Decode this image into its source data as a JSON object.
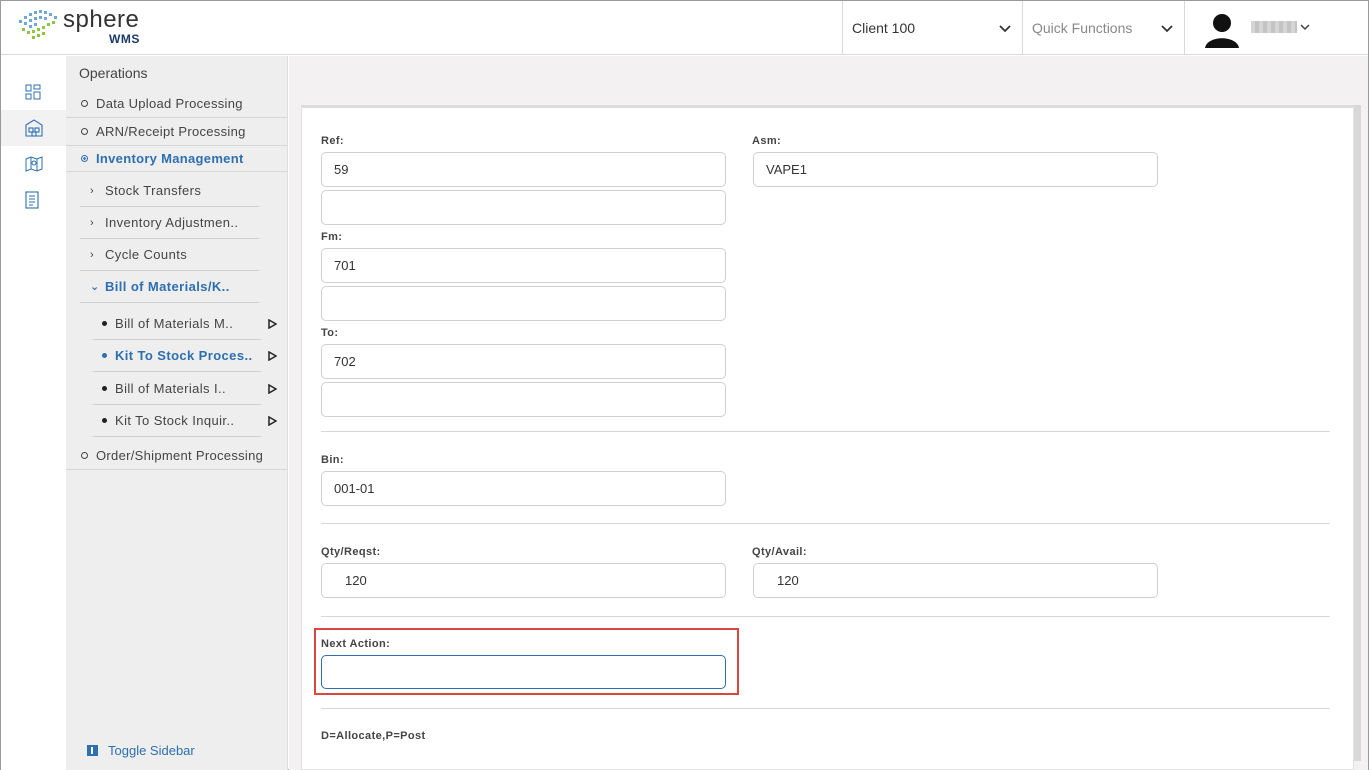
{
  "header": {
    "brand_name": "sphere",
    "brand_sub": "WMS",
    "client_select": "Client 100",
    "quick_functions": "Quick Functions"
  },
  "rail": {
    "icons": [
      "dashboard-icon",
      "warehouse-icon",
      "map-icon",
      "report-icon"
    ]
  },
  "sidebar": {
    "title": "Operations",
    "items": {
      "data_upload": "Data Upload Processing",
      "arn_receipt": "ARN/Receipt Processing",
      "inventory_mgmt": "Inventory Management",
      "stock_transfers": "Stock Transfers",
      "inventory_adjust": "Inventory Adjustmen..",
      "cycle_counts": "Cycle Counts",
      "bom_kits": "Bill of Materials/K..",
      "bom_maint": "Bill of Materials M..",
      "kit_to_stock_proc": "Kit To Stock Proces..",
      "bom_inquiry": "Bill of Materials I..",
      "kit_to_stock_inq": "Kit To Stock Inquir..",
      "order_shipment": "Order/Shipment Processing"
    },
    "toggle": "Toggle Sidebar"
  },
  "form": {
    "ref_label": "Ref:",
    "ref_value": "59",
    "ref_value2": "",
    "asm_label": "Asm:",
    "asm_value": "VAPE1",
    "fm_label": "Fm:",
    "fm_value": "701",
    "fm_value2": "",
    "to_label": "To:",
    "to_value": "702",
    "to_value2": "",
    "bin_label": "Bin:",
    "bin_value": "001-01",
    "qty_reqst_label": "Qty/Reqst:",
    "qty_reqst_value": "120",
    "qty_avail_label": "Qty/Avail:",
    "qty_avail_value": "120",
    "next_action_label": "Next Action:",
    "next_action_value": "",
    "hint": "D=Allocate,P=Post"
  },
  "colors": {
    "accent": "#2d6fb0",
    "highlight": "#d9473f"
  }
}
